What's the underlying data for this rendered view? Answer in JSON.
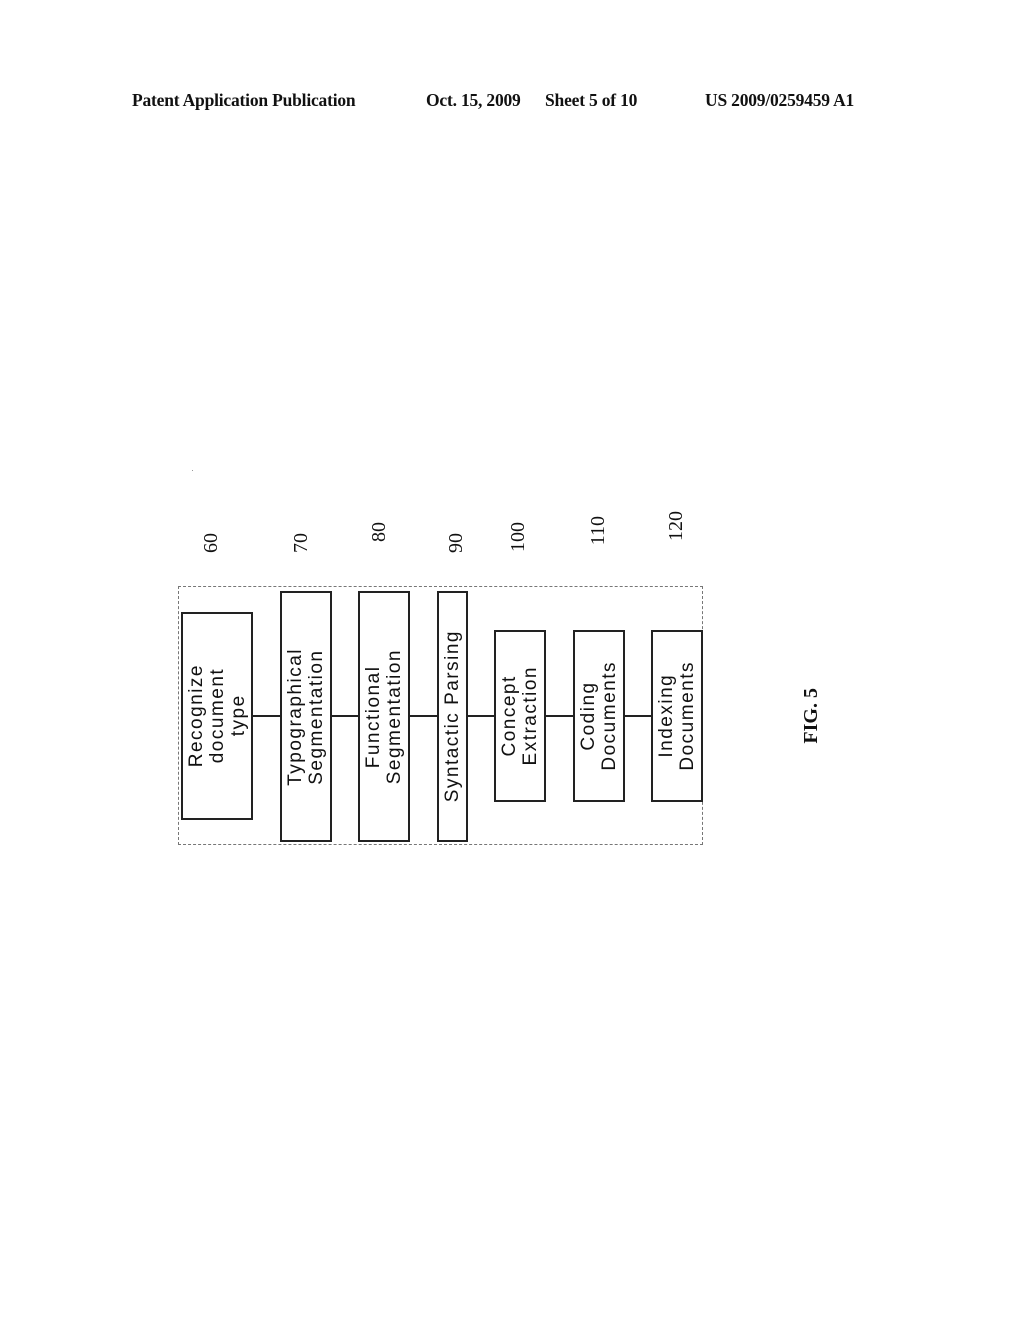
{
  "header": {
    "publication": "Patent Application Publication",
    "date": "Oct. 15, 2009",
    "sheet": "Sheet 5 of 10",
    "patent_number": "US 2009/0259459 A1"
  },
  "diagram": {
    "figure_label": "FIG. 5",
    "steps": [
      {
        "ref": "60",
        "label": "Recognize\ndocument\ntype"
      },
      {
        "ref": "70",
        "label": "Typographical\nSegmentation"
      },
      {
        "ref": "80",
        "label": "Functional\nSegmentation"
      },
      {
        "ref": "90",
        "label": "Syntactic Parsing"
      },
      {
        "ref": "100",
        "label": "Concept\nExtraction"
      },
      {
        "ref": "110",
        "label": "Coding\nDocuments"
      },
      {
        "ref": "120",
        "label": "Indexing\nDocuments"
      }
    ]
  }
}
